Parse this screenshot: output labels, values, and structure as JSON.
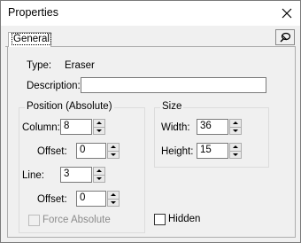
{
  "window": {
    "title": "Properties",
    "close_icon": "close-icon"
  },
  "tabs": [
    {
      "label": "General",
      "selected": true
    }
  ],
  "pin_icon": "pin-icon",
  "general": {
    "type_label": "Type:",
    "type_value": "Eraser",
    "description_label": "Description:",
    "description_value": ""
  },
  "position": {
    "title": "Position (Absolute)",
    "column_label": "Column:",
    "column_value": "8",
    "column_offset_label": "Offset:",
    "column_offset_value": "0",
    "line_label": "Line:",
    "line_value": "3",
    "line_offset_label": "Offset:",
    "line_offset_value": "0",
    "force_absolute_label": "Force Absolute",
    "force_absolute_checked": false,
    "force_absolute_enabled": false
  },
  "size": {
    "title": "Size",
    "width_label": "Width:",
    "width_value": "36",
    "height_label": "Height:",
    "height_value": "15"
  },
  "hidden": {
    "label": "Hidden",
    "checked": false
  }
}
